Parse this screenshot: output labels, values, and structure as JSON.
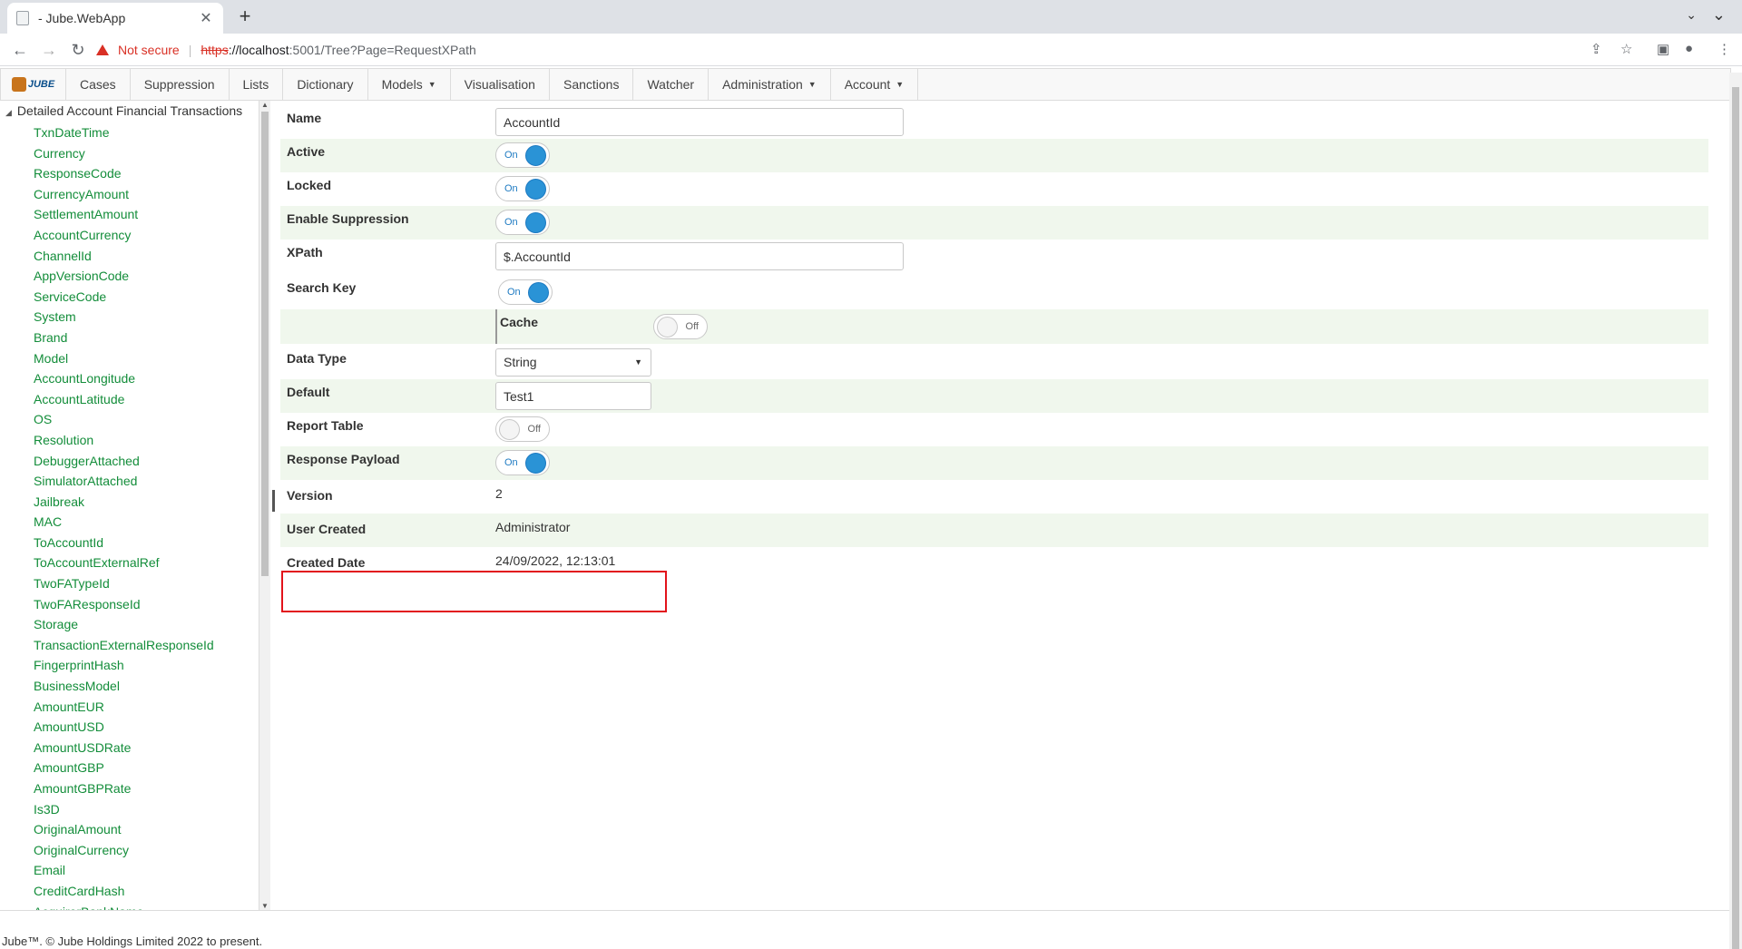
{
  "browser": {
    "tab_title": "- Jube.WebApp",
    "tab_close": "✕",
    "new_tab": "+",
    "tab_menu": "⌄",
    "minimize": "⌄",
    "not_secure": "Not secure",
    "url_https": "https",
    "url_host": "://localhost",
    "url_path": ":5001/Tree?Page=RequestXPath"
  },
  "nav": {
    "logo_text": "JUBE",
    "items": [
      {
        "label": "Cases"
      },
      {
        "label": "Suppression"
      },
      {
        "label": "Lists"
      },
      {
        "label": "Dictionary"
      },
      {
        "label": "Models",
        "dropdown": true
      },
      {
        "label": "Visualisation"
      },
      {
        "label": "Sanctions"
      },
      {
        "label": "Watcher"
      },
      {
        "label": "Administration",
        "dropdown": true
      },
      {
        "label": "Account",
        "dropdown": true
      }
    ]
  },
  "tree": {
    "root": "Detailed Account Financial Transactions",
    "items": [
      "TxnDateTime",
      "Currency",
      "ResponseCode",
      "CurrencyAmount",
      "SettlementAmount",
      "AccountCurrency",
      "ChannelId",
      "AppVersionCode",
      "ServiceCode",
      "System",
      "Brand",
      "Model",
      "AccountLongitude",
      "AccountLatitude",
      "OS",
      "Resolution",
      "DebuggerAttached",
      "SimulatorAttached",
      "Jailbreak",
      "MAC",
      "ToAccountId",
      "ToAccountExternalRef",
      "TwoFATypeId",
      "TwoFAResponseId",
      "Storage",
      "TransactionExternalResponseId",
      "FingerprintHash",
      "BusinessModel",
      "AmountEUR",
      "AmountUSD",
      "AmountUSDRate",
      "AmountGBP",
      "AmountGBPRate",
      "Is3D",
      "OriginalAmount",
      "OriginalCurrency",
      "Email",
      "CreditCardHash",
      "AcquirerBankName"
    ]
  },
  "form": {
    "name_label": "Name",
    "name_value": "AccountId",
    "active_label": "Active",
    "locked_label": "Locked",
    "enable_suppression_label": "Enable Suppression",
    "xpath_label": "XPath",
    "xpath_value": "$.AccountId",
    "search_key_label": "Search Key",
    "cache_label": "Cache",
    "data_type_label": "Data Type",
    "data_type_value": "String",
    "default_label": "Default",
    "default_value": "Test1",
    "report_table_label": "Report Table",
    "response_payload_label": "Response Payload",
    "version_label": "Version",
    "version_value": "2",
    "user_created_label": "User Created",
    "user_created_value": "Administrator",
    "created_date_label": "Created Date",
    "created_date_value": "24/09/2022, 12:13:01",
    "on_text": "On",
    "off_text": "Off"
  },
  "toggles": {
    "active": true,
    "locked": true,
    "enable_suppression": true,
    "search_key": true,
    "cache": false,
    "report_table": false,
    "response_payload": true
  },
  "footer": "Jube™. © Jube Holdings Limited 2022 to present.",
  "colors": {
    "tree_link": "#138d3a",
    "toggle_on": "#2a93d6",
    "row_alt": "#f0f7ed",
    "highlight": "#e2131b"
  }
}
